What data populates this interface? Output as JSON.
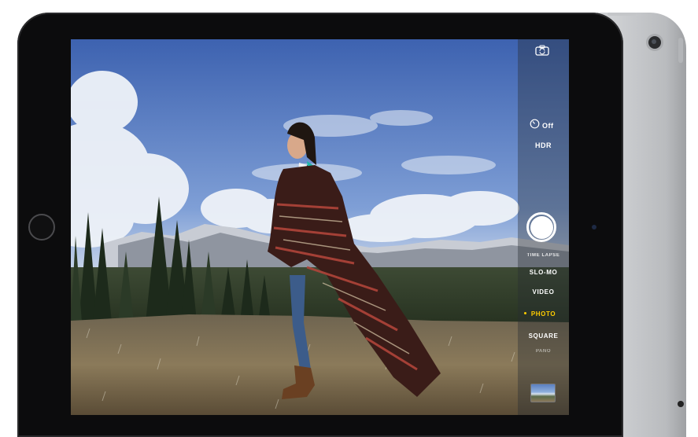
{
  "camera": {
    "flip_icon": "camera-flip-icon",
    "timer_icon": "timer-icon",
    "timer_label": "Off",
    "hdr_label": "HDR",
    "modes": [
      {
        "label": "TIME LAPSE",
        "state": "available"
      },
      {
        "label": "SLO-MO",
        "state": "available"
      },
      {
        "label": "VIDEO",
        "state": "available"
      },
      {
        "label": "PHOTO",
        "state": "selected"
      },
      {
        "label": "SQUARE",
        "state": "available"
      },
      {
        "label": "PANO",
        "state": "available"
      }
    ],
    "selected_mode_color": "#ffcc00",
    "shutter_color": "#ffffff"
  },
  "device": {
    "front_color": "#0c0c0d",
    "back_color": "#cfd1d4"
  }
}
